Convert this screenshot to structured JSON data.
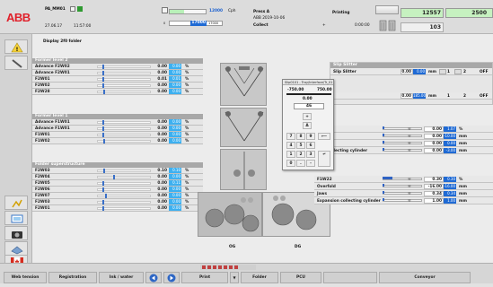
{
  "header": {
    "logo": "ABB",
    "station": "PA_MM01",
    "date": "27.06.17",
    "time": "11:57:00",
    "speed_value": "12000",
    "speed_unit": "Cph",
    "speed_sub_value": "17000",
    "speed_left": "0",
    "speed_right": "17000",
    "press_label": "Press A",
    "job_code": "ABB 2019-10-06",
    "job_type": "Collect",
    "plus_sign": "+",
    "status": "Printing",
    "elapsed": "0:00:00",
    "counter_main": "12557",
    "counter_right": "2500",
    "counter_sub": "103"
  },
  "panel": {
    "title": "Display 2f0 folder"
  },
  "former_level2": {
    "header": "Former level 2",
    "rows": [
      {
        "label": "Advance F2W02",
        "value": "0.00",
        "bvalue": "0.00",
        "unit": "%",
        "marker": 0.1
      },
      {
        "label": "Advance F2W01",
        "value": "0.00",
        "bvalue": "0.00",
        "unit": "%",
        "marker": 0.1
      },
      {
        "label": "F2W01",
        "value": "0.01",
        "bvalue": "0.01",
        "unit": "%",
        "marker": 0.1
      },
      {
        "label": "F2W02",
        "value": "0.00",
        "bvalue": "0.00",
        "unit": "%",
        "marker": 0.1
      },
      {
        "label": "F2W28",
        "value": "0.00",
        "bvalue": "0.00",
        "unit": "%",
        "marker": 0.12
      }
    ]
  },
  "former_level1": {
    "header": "Former level 1",
    "rows": [
      {
        "label": "Advance F1W01",
        "value": "0.00",
        "bvalue": "0.00",
        "unit": "%",
        "marker": 0.1
      },
      {
        "label": "Advance F1W01",
        "value": "0.00",
        "bvalue": "0.00",
        "unit": "%",
        "marker": 0.1
      },
      {
        "label": "F1W01",
        "value": "0.00",
        "bvalue": "0.00",
        "unit": "%",
        "marker": 0.1
      },
      {
        "label": "F1W02",
        "value": "0.00",
        "bvalue": "0.00",
        "unit": "%",
        "marker": 0.12
      }
    ]
  },
  "folder_superstructure": {
    "header": "Folder superstructure",
    "rows": [
      {
        "label": "F2W03",
        "value": "0.10",
        "bvalue": "0.10",
        "unit": "%",
        "marker": 0.12
      },
      {
        "label": "F2W04",
        "value": "0.00",
        "bvalue": "0.00",
        "unit": "%",
        "marker": 0.3
      },
      {
        "label": "F2W05",
        "value": "0.00",
        "bvalue": "0.11",
        "unit": "%",
        "marker": 0.1
      },
      {
        "label": "F2W06",
        "value": "0.00",
        "bvalue": "0.00",
        "unit": "%",
        "marker": 0.1
      },
      {
        "label": "F2W07",
        "value": "0.00",
        "bvalue": "0.00",
        "unit": "%",
        "marker": 0.15
      },
      {
        "label": "F2W03",
        "value": "0.00",
        "bvalue": "0.00",
        "unit": "%",
        "marker": 0.1
      },
      {
        "label": "F2W01",
        "value": "0.00",
        "bvalue": "0.00",
        "unit": "%",
        "marker": 0.1
      }
    ]
  },
  "slitter": {
    "header": "Slip Slitter",
    "row_label": "Slip Slitter",
    "value": "0.00",
    "bvalue": "0.00",
    "unit": "mm",
    "btn1": "1",
    "btn2": "2",
    "off": "OFF",
    "row2_value": "0.00",
    "row2_bvalue": "185.00",
    "row2_unit": "mm"
  },
  "right_rows": [
    {
      "label": "2",
      "value": "0.00",
      "bvalue": "1.07",
      "unit": "%",
      "fill": 0.0
    },
    {
      "label": "12",
      "value": "0.00",
      "bvalue": "-10.00",
      "unit": "mm",
      "fill": 0.0
    },
    {
      "label": "",
      "value": "0.00",
      "bvalue": "0.00",
      "unit": "mm",
      "fill": 0.0
    },
    {
      "label": "sion collecting cylinder",
      "value": "0.00",
      "bvalue": "-3.00",
      "unit": "mm",
      "fill": 0.0
    }
  ],
  "lower_right_rows": [
    {
      "label": "F1W22",
      "value": "0.30",
      "bvalue": "0.30",
      "unit": "%",
      "fill": 0.25
    },
    {
      "label": "Overfold",
      "value": "-16.00",
      "bvalue": "-16.00",
      "unit": "mm",
      "fill": 0.0
    },
    {
      "label": "Jaws",
      "value": "0.34",
      "bvalue": "0.34",
      "unit": "mm",
      "fill": 0.0
    },
    {
      "label": "Expansion collecting cylinder",
      "value": "1.00",
      "bvalue": "1.00",
      "unit": "mm",
      "fill": 0.0
    }
  ],
  "popup": {
    "title": "Slip0101 - Tray/Interface/Tr_01",
    "min": "-750.00",
    "max": "750.00",
    "current": "0.00",
    "input": "46",
    "keys": [
      "7",
      "8",
      "9",
      "4",
      "5",
      "6",
      "1",
      "2",
      "3",
      "0",
      ".",
      "-"
    ],
    "plus": "+",
    "up": "Δ"
  },
  "folder_labels": {
    "left": "OG",
    "right": "DG"
  },
  "bottom": {
    "web_tension": "Web tension",
    "registration": "Registration",
    "ink_water": "Ink / water",
    "print": "Print",
    "folder": "Folder",
    "pcu": "PCU",
    "conveyor": "Conveyor"
  }
}
